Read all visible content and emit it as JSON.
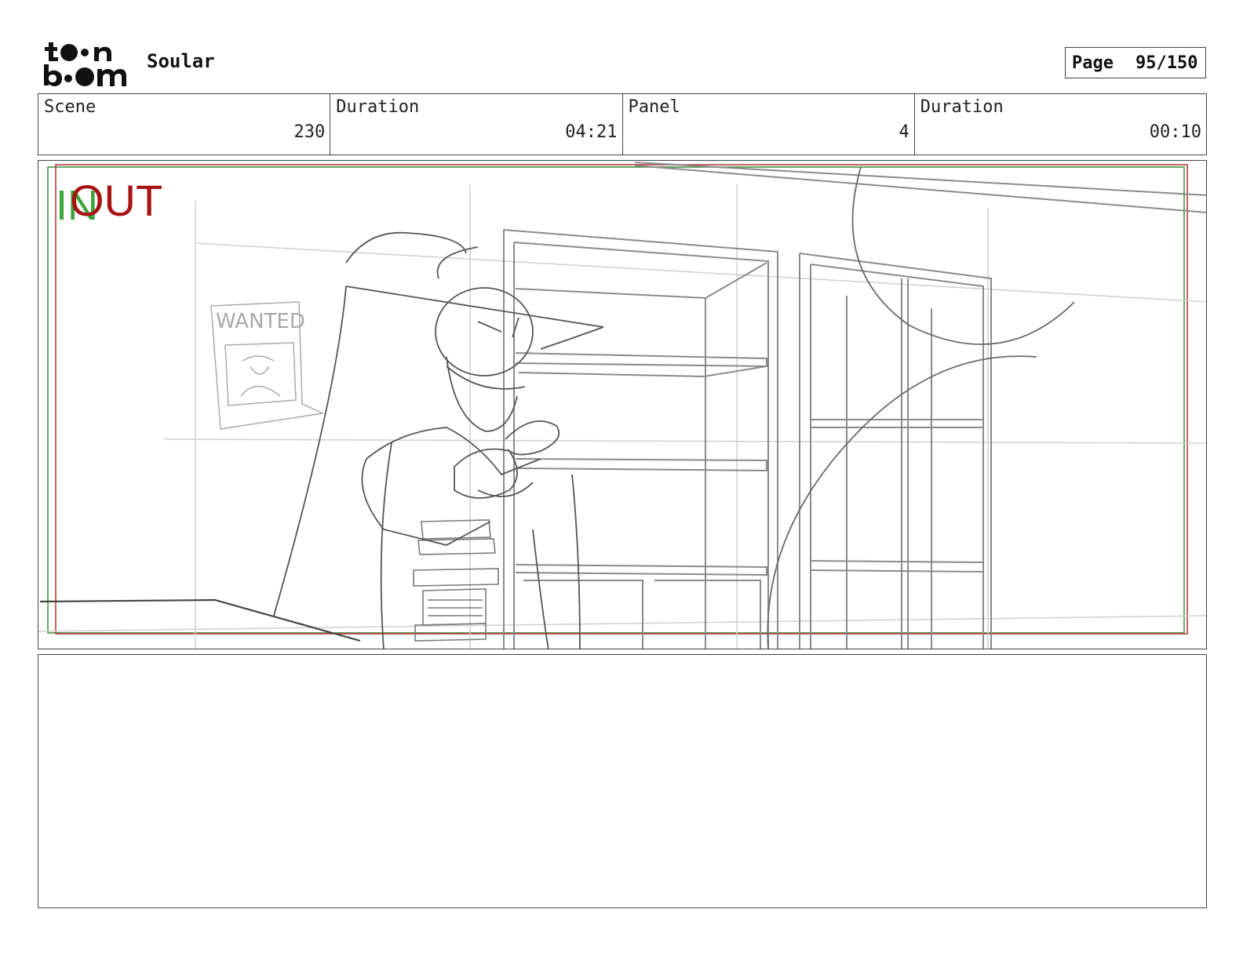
{
  "header": {
    "logo_text": "toon boom",
    "project_title": "Soular",
    "page_label": "Page",
    "page_number": "95/150"
  },
  "info": {
    "scene_label": "Scene",
    "scene_value": "230",
    "scene_duration_label": "Duration",
    "scene_duration_value": "04:21",
    "panel_label": "Panel",
    "panel_value": "4",
    "panel_duration_label": "Duration",
    "panel_duration_value": "00:10"
  },
  "panel": {
    "in_marker": "IN",
    "out_marker": "OUT",
    "poster_text": "WANTED",
    "colors": {
      "in": "#3aa53a",
      "out": "#a81414",
      "sketch": "#555555"
    }
  },
  "notes": {
    "text": ""
  }
}
